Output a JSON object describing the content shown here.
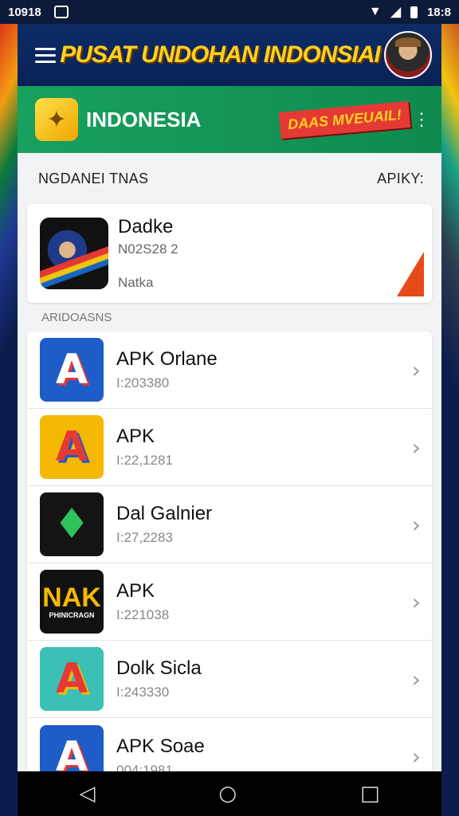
{
  "status_bar": {
    "time_left": "10918",
    "time_right": "18:8"
  },
  "header": {
    "title": "PUSAT UNDOHAN INDONSIAI"
  },
  "banner": {
    "title": "INDONESIA",
    "badge": "DAAS MVEUAIL!",
    "more": "⋮"
  },
  "section": {
    "left": "NGDANEI TNAS",
    "right": "APIKY:"
  },
  "featured": {
    "name": "Dadke",
    "version": "N02S28 2",
    "subtitle": "Natka"
  },
  "list_caption": "ARIDOASNS",
  "apps": [
    {
      "name": "APK Orlane",
      "version": "I:203380",
      "icon_color": "#1e5cc8"
    },
    {
      "name": "APK",
      "version": "I:22,1281",
      "icon_color": "#f5b800"
    },
    {
      "name": "Dal Galnier",
      "version": "I:27,2283",
      "icon_color": "#141414"
    },
    {
      "name": "APK",
      "version": "I:221038",
      "icon_color": "#111111",
      "icon_text_top": "NAK",
      "icon_text_bottom": "PHINICRAGN"
    },
    {
      "name": "Dolk Sicla",
      "version": "I:243330",
      "icon_color": "#3ac0b5"
    },
    {
      "name": "APK Soae",
      "version": "004:1981",
      "icon_color": "#1e5cc8"
    }
  ],
  "chevron": "›",
  "nav": {
    "back": "◁",
    "home": "○",
    "recent": "□"
  }
}
